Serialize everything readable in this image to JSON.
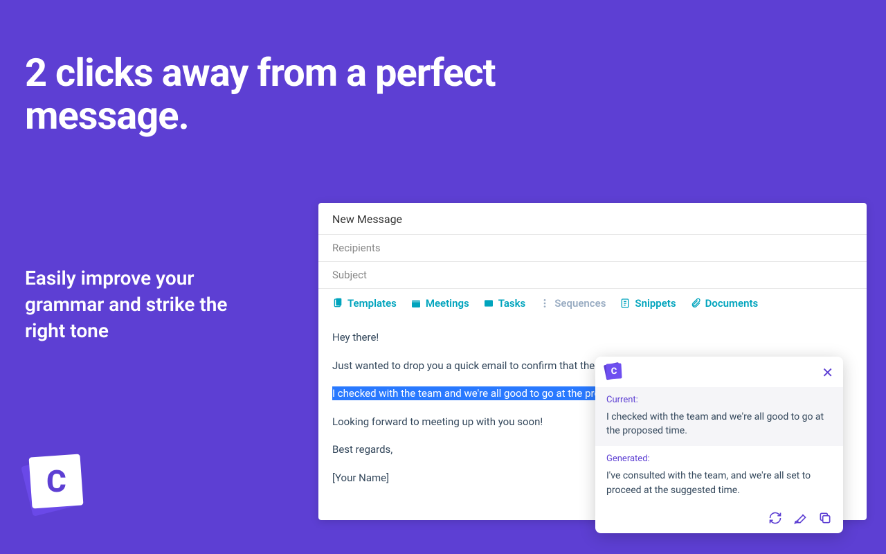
{
  "hero": {
    "headline": "2 clicks away from a perfect message.",
    "subheadline": "Easily improve your grammar and strike the right tone"
  },
  "logo_letter": "C",
  "compose": {
    "title": "New Message",
    "recipients_placeholder": "Recipients",
    "subject_placeholder": "Subject",
    "toolbar": {
      "templates": "Templates",
      "meetings": "Meetings",
      "tasks": "Tasks",
      "sequences": "Sequences",
      "snippets": "Snippets",
      "documents": "Documents"
    },
    "body": {
      "line1": "Hey there!",
      "line2": "Just wanted to drop you a quick email to confirm that the meeting time works for us.",
      "highlighted": "I checked with the team and we're all good to go at the proposed tim",
      "line4": "Looking forward to meeting up with you soon!",
      "line5": "Best regards,",
      "line6": "[Your Name]"
    }
  },
  "popup": {
    "current_label": "Current:",
    "current_text": "I checked with the team and we're all good to go at the proposed time.",
    "generated_label": "Generated:",
    "generated_text": "I've consulted with the team, and we're all set to proceed at the suggested time."
  }
}
